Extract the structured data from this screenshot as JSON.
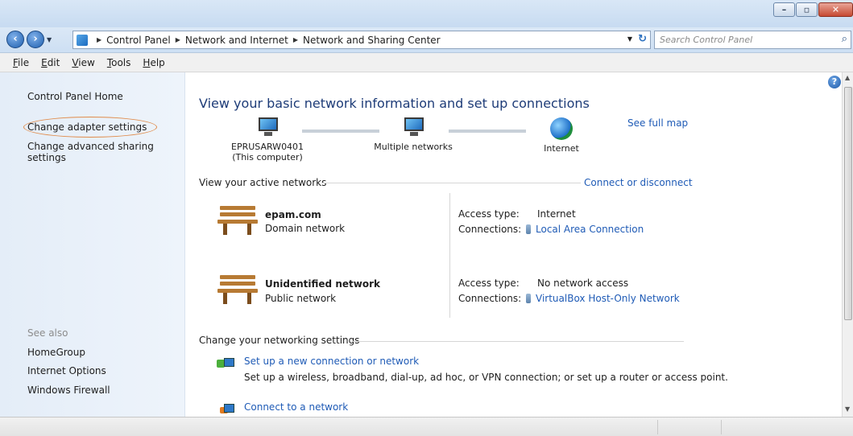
{
  "address": {
    "crumbs": [
      "Control Panel",
      "Network and Internet",
      "Network and Sharing Center"
    ],
    "search_placeholder": "Search Control Panel"
  },
  "menu": [
    "File",
    "Edit",
    "View",
    "Tools",
    "Help"
  ],
  "sidebar": {
    "home": "Control Panel Home",
    "adapter": "Change adapter settings",
    "advanced": "Change advanced sharing settings",
    "see_also": "See also",
    "links": [
      "HomeGroup",
      "Internet Options",
      "Windows Firewall"
    ]
  },
  "main": {
    "heading": "View your basic network information and set up connections",
    "see_full_map": "See full map",
    "map": {
      "computer_name": "EPRUSARW0401",
      "computer_sub": "(This computer)",
      "middle": "Multiple networks",
      "end": "Internet"
    },
    "active_title": "View your active networks",
    "connect_link": "Connect or disconnect",
    "labels": {
      "access_type": "Access type:",
      "connections": "Connections:"
    },
    "networks": [
      {
        "name": "epam.com",
        "type": "Domain network",
        "access": "Internet",
        "connection": "Local Area Connection"
      },
      {
        "name": "Unidentified network",
        "type": "Public network",
        "access": "No network access",
        "connection": "VirtualBox Host-Only Network"
      }
    ],
    "change_title": "Change your networking settings",
    "tasks": [
      {
        "title": "Set up a new connection or network",
        "desc": "Set up a wireless, broadband, dial-up, ad hoc, or VPN connection; or set up a router or access point."
      },
      {
        "title": "Connect to a network"
      }
    ]
  }
}
